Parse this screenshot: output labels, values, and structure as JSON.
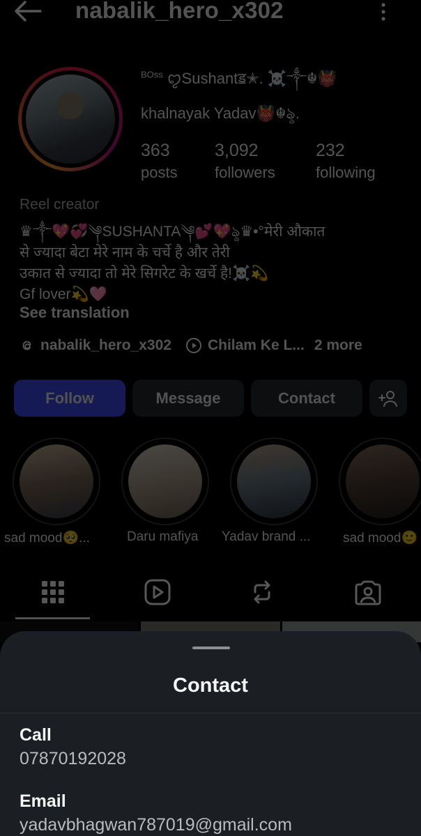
{
  "profile": {
    "username": "nabalik_hero_x302",
    "name_line1_prefix": "BOss",
    "name_line1": "ꨄ︎Sushantॾ✭. ☠️༒☬👹",
    "name_line2": "khalnayak Yadav👹☬ৡ.",
    "stats": [
      {
        "number": "363",
        "label": "posts"
      },
      {
        "number": "3,092",
        "label": "followers"
      },
      {
        "number": "232",
        "label": "following"
      }
    ],
    "category": "Reel creator",
    "bio_lines": [
      "♛༒💖💞༆SUSHANTA༆💕💖ৡ♛•°मेरी औकात",
      "से ज्यादा बेटा मेरे नाम के चर्चे है और तेरी",
      "उकात से ज्यादा तो मेरे सिगरेट के खर्चे है!☠️💫",
      "Gf lover💫🩷"
    ],
    "see_translation": "See translation",
    "threads_link": "nabalik_hero_x302",
    "reel_link": "Chilam Ke L...",
    "more_links": "2 more"
  },
  "actions": {
    "follow": "Follow",
    "message": "Message",
    "contact": "Contact",
    "add_user_icon": "add-person-icon"
  },
  "highlights": [
    {
      "label": "sad mood🥺..."
    },
    {
      "label": "Daru mafiya"
    },
    {
      "label": "Yadav brand ..."
    },
    {
      "label": "sad mood🙂"
    }
  ],
  "tabs": [
    "grid-icon",
    "reels-icon",
    "reposts-icon",
    "tagged-icon"
  ],
  "sheet": {
    "title": "Contact",
    "call_label": "Call",
    "call_value": "07870192028",
    "email_label": "Email",
    "email_value": "yadavbhagwan787019@gmail.com"
  },
  "colors": {
    "follow_button": "#4150f7",
    "button_bg": "#262a2f",
    "sheet_bg": "#1b1f23"
  }
}
